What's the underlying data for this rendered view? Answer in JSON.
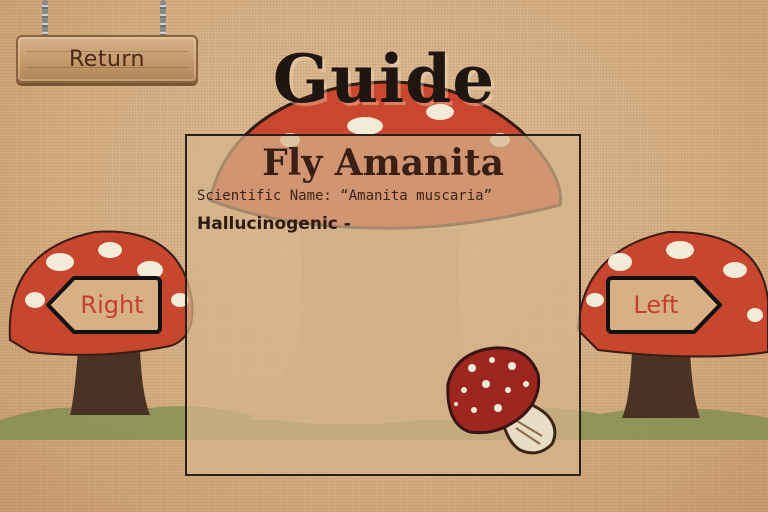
{
  "nav": {
    "return_label": "Return"
  },
  "page": {
    "title": "Guide"
  },
  "card": {
    "name": "Fly Amanita",
    "scientific_name": "Scientific Name: “Amanita muscaria”",
    "effect": "Hallucinogenic -"
  },
  "arrows": {
    "right_label": "Right",
    "left_label": "Left"
  },
  "colors": {
    "accent": "#c4402a",
    "cap_red": "#c8442a",
    "text_dark": "#3a2014"
  }
}
